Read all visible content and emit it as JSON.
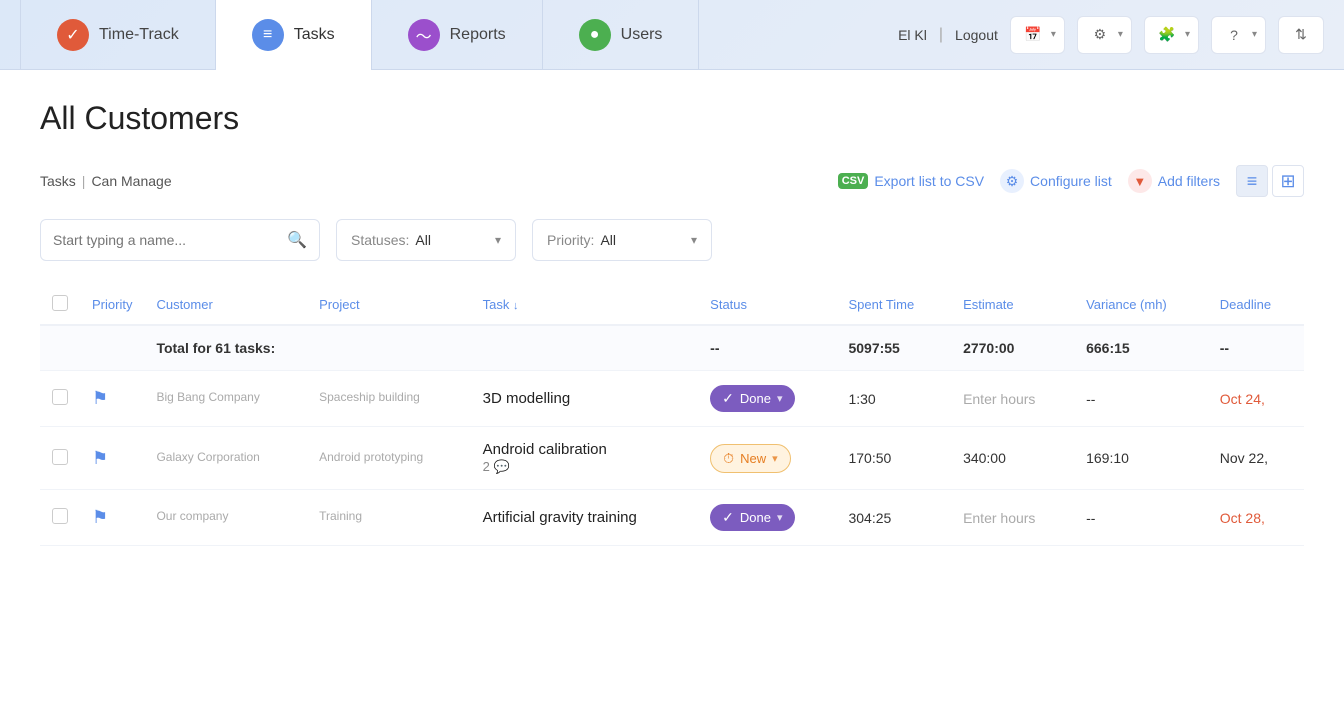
{
  "nav": {
    "tabs": [
      {
        "id": "timetrack",
        "label": "Time-Track",
        "icon": "⏱",
        "iconClass": "icon-timetrack",
        "active": false
      },
      {
        "id": "tasks",
        "label": "Tasks",
        "icon": "≡",
        "iconClass": "icon-tasks",
        "active": true
      },
      {
        "id": "reports",
        "label": "Reports",
        "icon": "📈",
        "iconClass": "icon-reports",
        "active": false
      },
      {
        "id": "users",
        "label": "Users",
        "icon": "👤",
        "iconClass": "icon-users",
        "active": false
      }
    ],
    "user": "El Kl",
    "logout": "Logout"
  },
  "page": {
    "title": "All Customers"
  },
  "toolbar": {
    "tasks_label": "Tasks",
    "can_manage_label": "Can Manage",
    "export_csv": "Export list to CSV",
    "configure_list": "Configure list",
    "add_filters": "Add filters"
  },
  "filters": {
    "search_placeholder": "Start typing a name...",
    "statuses_label": "Statuses:",
    "statuses_value": "All",
    "priority_label": "Priority:",
    "priority_value": "All"
  },
  "table": {
    "columns": [
      "Priority",
      "Customer",
      "Project",
      "Task",
      "Status",
      "Spent Time",
      "Estimate",
      "Variance (mh)",
      "Deadline"
    ],
    "total_row": {
      "label": "Total for 61 tasks:",
      "status": "--",
      "spent": "5097:55",
      "estimate": "2770:00",
      "variance": "666:15",
      "deadline": "--"
    },
    "rows": [
      {
        "priority_flag": true,
        "customer": "Big Bang Company",
        "project": "Spaceship building",
        "task": "3D modelling",
        "comments": null,
        "status": "Done",
        "status_type": "done",
        "spent": "1:30",
        "estimate": "Enter hours",
        "variance": "--",
        "deadline": "Oct 24,",
        "deadline_type": "overdue"
      },
      {
        "priority_flag": true,
        "customer": "Galaxy Corporation",
        "project": "Android prototyping",
        "task": "Android calibration",
        "comments": 2,
        "status": "New",
        "status_type": "new",
        "spent": "170:50",
        "estimate": "340:00",
        "variance": "169:10",
        "deadline": "Nov 22,",
        "deadline_type": "normal"
      },
      {
        "priority_flag": true,
        "customer": "Our company",
        "project": "Training",
        "task": "Artificial gravity training",
        "comments": null,
        "status": "Done",
        "status_type": "done",
        "spent": "304:25",
        "estimate": "Enter hours",
        "variance": "--",
        "deadline": "Oct 28,",
        "deadline_type": "overdue"
      }
    ]
  }
}
